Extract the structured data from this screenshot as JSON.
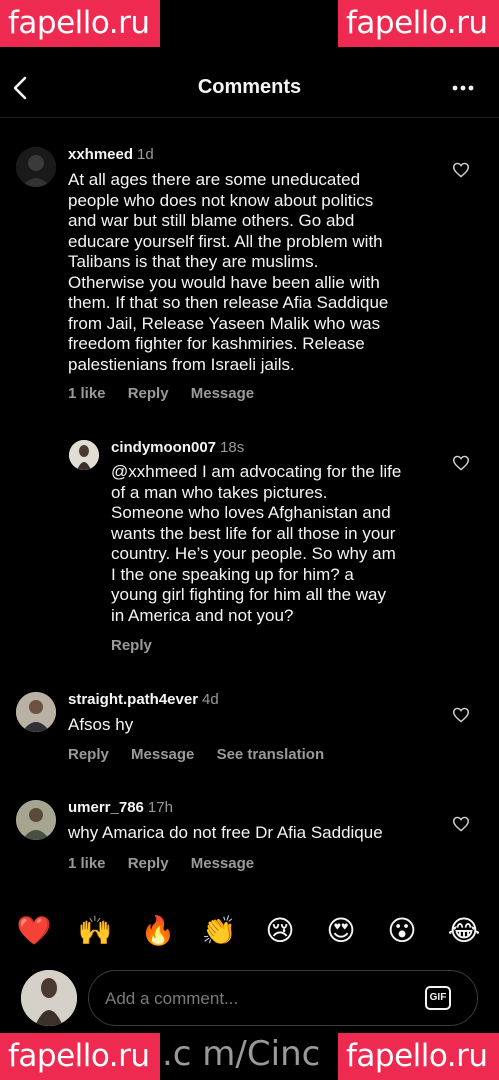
{
  "header": {
    "title": "Comments"
  },
  "comments": [
    {
      "username": "xxhmeed",
      "time": "1d",
      "lines": [
        "At all ages there are some uneducated",
        "people who does not know about politics",
        "and war but still blame others. Go abd",
        "educare yourself first. All the problem with",
        "Talibans is that they are muslims.",
        "Otherwise you would have been allie with",
        "them. If that so then release Afia Saddique",
        "from Jail, Release Yaseen Malik who was",
        "freedom fighter for kashmiries. Release",
        "palestienians from Israeli jails."
      ],
      "likes": "1 like",
      "reply": "Reply",
      "message": "Message"
    },
    {
      "username": "cindymoon007",
      "time": "18s",
      "lines": [
        "@xxhmeed I am advocating for the life",
        "of a man who takes pictures.",
        "Someone who loves Afghanistan and",
        "wants the best life for all those in your",
        "country. He’s your people. So why am",
        "I the one speaking up for him? a",
        "young girl fighting for him all the way",
        "in America and not you?"
      ],
      "reply": "Reply"
    },
    {
      "username": "straight.path4ever",
      "time": "4d",
      "lines": [
        "Afsos hy"
      ],
      "reply": "Reply",
      "message": "Message",
      "translate": "See translation"
    },
    {
      "username": "umerr_786",
      "time": "17h",
      "lines": [
        "why Amarica do not free Dr Afia Saddique"
      ],
      "likes": "1 like",
      "reply": "Reply",
      "message": "Message"
    }
  ],
  "reactions": [
    "❤️",
    "🙌",
    "🔥",
    "👏",
    "😢",
    "😍",
    "😮",
    "😂"
  ],
  "composer": {
    "placeholder": "Add a comment...",
    "gif": "GIF"
  },
  "watermarks": {
    "brand": "fapello.ru",
    "middle": ".c m/Cinc"
  },
  "colors": {
    "watermark": "#ee2a50",
    "background": "#000000",
    "secondary_text": "#9a9a9a"
  }
}
